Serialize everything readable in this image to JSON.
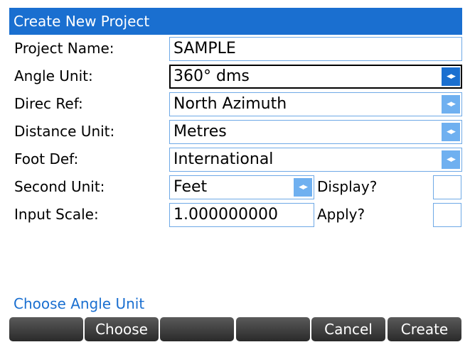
{
  "window": {
    "title": "Create New Project"
  },
  "form": {
    "project_name": {
      "label": "Project Name:",
      "value": "SAMPLE"
    },
    "angle_unit": {
      "label": "Angle Unit:",
      "value": "360° dms"
    },
    "direc_ref": {
      "label": "Direc Ref:",
      "value": "North Azimuth"
    },
    "distance_unit": {
      "label": "Distance Unit:",
      "value": "Metres"
    },
    "foot_def": {
      "label": "Foot Def:",
      "value": "International"
    },
    "second_unit": {
      "label": "Second Unit:",
      "value": "Feet",
      "checkbox_label": "Display?",
      "checked": false
    },
    "input_scale": {
      "label": "Input Scale:",
      "value": "1.000000000",
      "checkbox_label": "Apply?",
      "checked": false
    }
  },
  "status": {
    "text": "Choose Angle Unit"
  },
  "softkeys": [
    "",
    "Choose",
    "",
    "",
    "Cancel",
    "Create"
  ],
  "colors": {
    "accent": "#1a6fd0",
    "field_border": "#6fa9e6",
    "arrow_light": "#6fb0f0"
  },
  "icons": {
    "dropdown": "left-right-arrows-icon"
  }
}
